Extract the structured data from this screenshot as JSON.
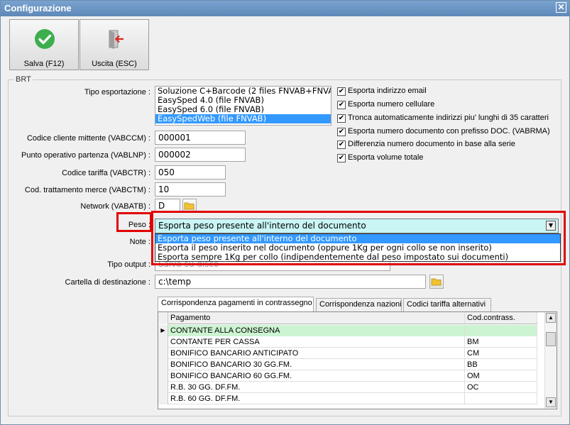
{
  "window": {
    "title": "Configurazione",
    "close_glyph": "✕"
  },
  "toolbar": {
    "save_label": "Salva (F12)",
    "exit_label": "Uscita (ESC)",
    "save_icon": "check-circle-icon",
    "exit_icon": "exit-door-icon",
    "save_color": "#3dae4e",
    "exit_color": "#d9251c"
  },
  "group": {
    "label": "BRT"
  },
  "form": {
    "tipo_esportazione_label": "Tipo esportazione :",
    "tipo_esportazione_items": [
      "Soluzione C+Barcode (2 files FNVAB+FNVA",
      "EasySped 4.0 (file FNVAB)",
      "EasySped 6.0 (file FNVAB)",
      "EasySpedWeb (file FNVAB)"
    ],
    "tipo_esportazione_selected_index": 3,
    "codice_cliente_label": "Codice cliente mittente (VABCCM) :",
    "codice_cliente_value": "000001",
    "punto_operativo_label": "Punto operativo partenza (VABLNP) :",
    "punto_operativo_value": "000002",
    "codice_tariffa_label": "Codice tariffa (VABCTR) :",
    "codice_tariffa_value": "050",
    "cod_trattamento_label": "Cod. trattamento merce (VABCTM) :",
    "cod_trattamento_value": "10",
    "network_label": "Network (VABATB) :",
    "network_value": "D",
    "peso_label": "Peso :",
    "peso_value": "Esporta peso presente all'interno del documento",
    "peso_options": [
      "Esporta peso presente all'interno del documento",
      "Esporta il peso inserito nel documento (oppure 1Kg per ogni collo se non inserito)",
      "Esporta sempre 1Kg per collo (indipendentemente dal peso impostato sui documenti)"
    ],
    "peso_highlight_index": 0,
    "note_label": "Note :",
    "tipo_output_label": "Tipo output :",
    "tipo_output_value": "Salva su disco",
    "cartella_label": "Cartella di destinazione :",
    "cartella_value": "c:\\temp"
  },
  "checkboxes": [
    {
      "label": "Esporta indirizzo email",
      "checked": true
    },
    {
      "label": "Esporta numero cellulare",
      "checked": true
    },
    {
      "label": "Tronca automaticamente indirizzi piu' lunghi di 35 caratteri",
      "checked": true
    },
    {
      "label": "Esporta numero documento con prefisso DOC. (VABRMA)",
      "checked": true
    },
    {
      "label": "Differenzia numero documento in base alla serie",
      "checked": true
    },
    {
      "label": "Esporta volume totale",
      "checked": true
    }
  ],
  "tabs": [
    {
      "label": "Corrispondenza pagamenti in contrassegno",
      "active": true
    },
    {
      "label": "Corrispondenza nazioni",
      "active": false
    },
    {
      "label": "Codici tariffa alternativi",
      "active": false
    }
  ],
  "grid": {
    "columns": [
      "Pagamento",
      "Cod.contrass."
    ],
    "current_row_marker": "▶",
    "current_row_color": "#cdf4d2",
    "rows": [
      [
        "CONTANTE ALLA CONSEGNA",
        ""
      ],
      [
        "CONTANTE PER CASSA",
        "BM"
      ],
      [
        "BONIFICO BANCARIO ANTICIPATO",
        "CM"
      ],
      [
        "BONIFICO BANCARIO 30 GG.FM.",
        "BB"
      ],
      [
        "BONIFICO BANCARIO 60 GG.FM.",
        "OM"
      ],
      [
        "R.B. 30 GG. DF.FM.",
        "OC"
      ],
      [
        "R.B. 60 GG. DF.FM.",
        ""
      ]
    ],
    "scroll_up": "▲",
    "scroll_down": "▼"
  },
  "highlight_color": "#e10000",
  "combo_arrow": "▼"
}
